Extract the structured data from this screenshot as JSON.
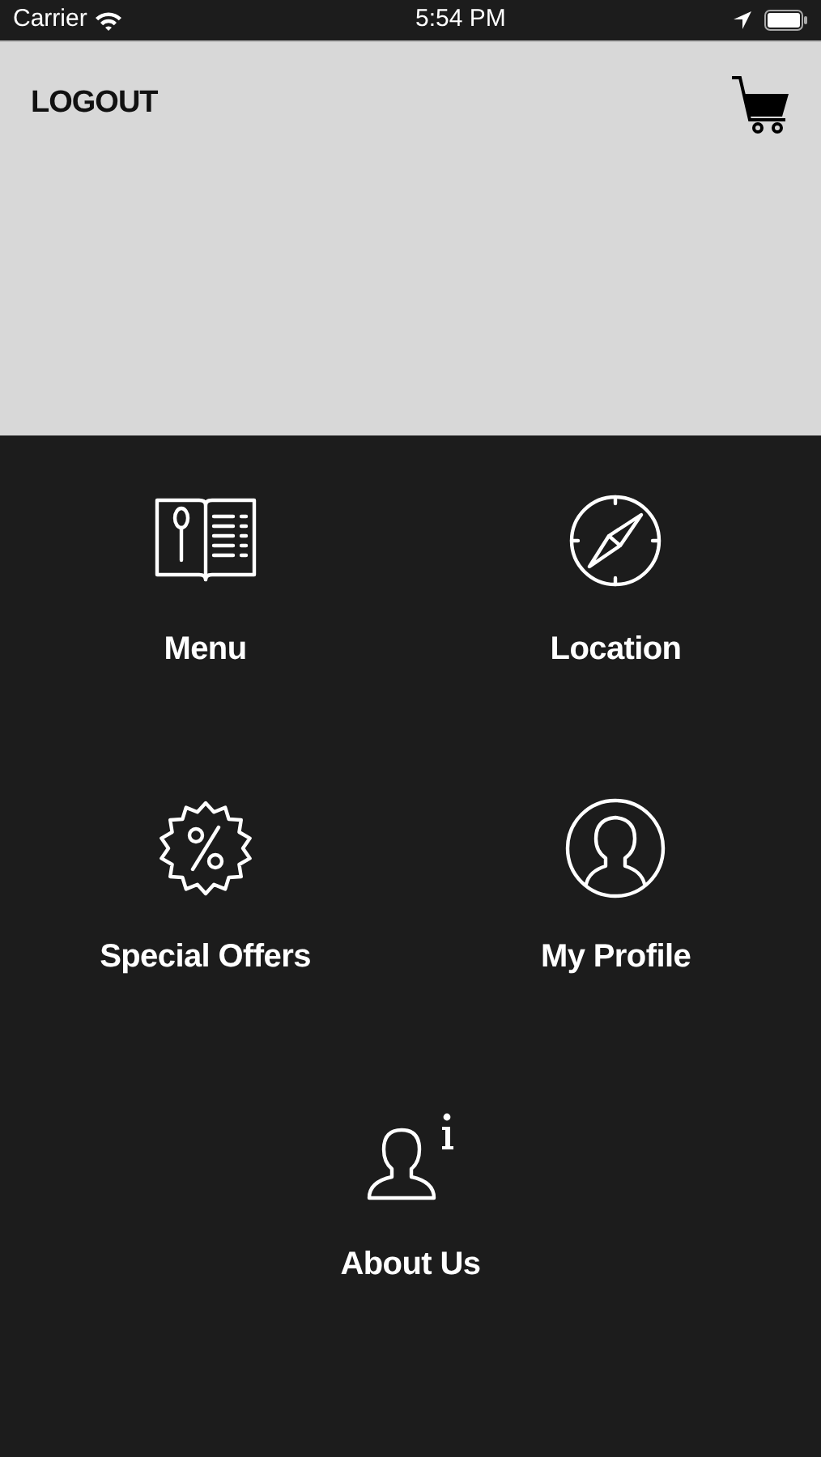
{
  "status_bar": {
    "carrier": "Carrier",
    "time": "5:54 PM"
  },
  "header": {
    "logout": "LOGOUT"
  },
  "tiles": [
    {
      "kind": "menu",
      "label": "Menu"
    },
    {
      "kind": "location",
      "label": "Location"
    },
    {
      "kind": "offers",
      "label": "Special Offers"
    },
    {
      "kind": "profile",
      "label": "My Profile"
    },
    {
      "kind": "about",
      "label": "About Us"
    }
  ]
}
